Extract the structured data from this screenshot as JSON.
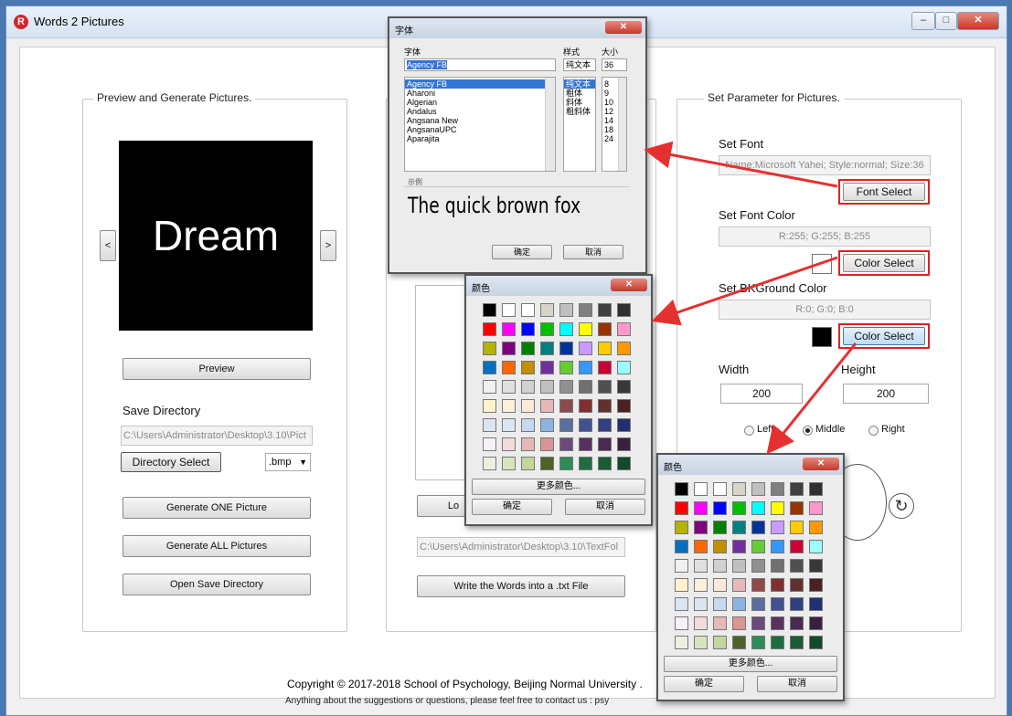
{
  "window": {
    "title": "Words 2 Pictures",
    "controls": [
      "–",
      "□",
      "✕"
    ]
  },
  "preview": {
    "group_title": "Preview and Generate Pictures.",
    "image_text": "Dream",
    "prev_label": "<",
    "next_label": ">",
    "preview_button": "Preview",
    "save_dir_label": "Save Directory",
    "save_dir_value": "C:\\Users\\Administrator\\Desktop\\3.10\\Pict",
    "dir_select_button": "Directory Select",
    "format_value": ".bmp",
    "generate_one_button": "Generate ONE Picture",
    "generate_all_button": "Generate ALL Pictures",
    "open_dir_button": "Open Save Directory"
  },
  "middle": {
    "load_button": "Lo",
    "txt_path": "C:\\Users\\Administrator\\Desktop\\3.10\\TextFol",
    "write_button": "Write the Words into a .txt File"
  },
  "params": {
    "group_title": "Set Parameter for Pictures.",
    "font_label": "Set Font",
    "font_value": "Name:Microsoft Yahei; Style:normal; Size:36",
    "font_select_button": "Font Select",
    "font_color_label": "Set Font Color",
    "font_color_value": "R:255; G:255; B:255",
    "color_select_button": "Color Select",
    "bg_color_label": "Set BKGround Color",
    "bg_color_value": "R:0; G:0; B:0",
    "bg_color_select_button": "Color Select",
    "width_label": "Width",
    "width_value": "200",
    "height_label": "Height",
    "height_value": "200",
    "align_left": "Left",
    "align_middle": "Middle",
    "align_right": "Right"
  },
  "footer": {
    "copyright": "Copyright © 2017-2018 School of Psychology, Beijing Normal University .",
    "contact": "Anything about the suggestions or questions, please feel free to contact us : psy"
  },
  "font_dialog": {
    "title": "字体",
    "font_col_label": "字体",
    "style_col_label": "样式",
    "size_col_label": "大小",
    "font_input": "Agency FB",
    "style_input": "纯文本",
    "size_input": "36",
    "fonts": [
      "Agency FB",
      "Aharoni",
      "Algerian",
      "Andalus",
      "Angsana New",
      "AngsanaUPC",
      "Aparajita"
    ],
    "styles": [
      "纯文本",
      "粗体",
      "斜体",
      "粗斜体"
    ],
    "sizes": [
      "8",
      "9",
      "10",
      "12",
      "14",
      "18",
      "24"
    ],
    "sample_label": "示例",
    "sample_text": "The quick brown fox",
    "ok_button": "确定",
    "cancel_button": "取消"
  },
  "color_dialog": {
    "title": "颜色",
    "more_colors_button": "更多颜色...",
    "ok_button": "确定",
    "cancel_button": "取消",
    "swatches": [
      [
        "#000000",
        "#ffffff",
        "#ffffff",
        "#d8d4c8",
        "#c0c0c0",
        "#808080",
        "#404040",
        "#303030"
      ],
      [
        "#ff0000",
        "#ff00ff",
        "#0000ff",
        "#00c000",
        "#00ffff",
        "#ffff00",
        "#993300",
        "#ff99cc"
      ],
      [
        "#b3b300",
        "#800080",
        "#008000",
        "#008080",
        "#003399",
        "#cc99ff",
        "#ffcc00",
        "#ff9900"
      ],
      [
        "#0070c0",
        "#ff6600",
        "#c09000",
        "#7030a0",
        "#66cc33",
        "#3399ff",
        "#cc0033",
        "#99ffff"
      ],
      [
        "#f0f0f0",
        "#e0e0e0",
        "#d0d0d0",
        "#c0c0c0",
        "#909090",
        "#707070",
        "#505050",
        "#383838"
      ],
      [
        "#fff2cc",
        "#fff0d9",
        "#fde9d9",
        "#e6b9b8",
        "#8c4a4a",
        "#803030",
        "#633030",
        "#4a2020"
      ],
      [
        "#dbe5f1",
        "#dce6f2",
        "#c6d9f0",
        "#8db3e2",
        "#5a6fa0",
        "#405090",
        "#304080",
        "#203070"
      ],
      [
        "#f8f0f8",
        "#f2dcdb",
        "#e5b9b7",
        "#d99694",
        "#6a4a7a",
        "#5a3060",
        "#4a2a50",
        "#3a2040"
      ],
      [
        "#ebf1de",
        "#d7e4bc",
        "#c3d69b",
        "#4f6228",
        "#2e8b57",
        "#1e6e40",
        "#1a5c36",
        "#124a2a"
      ]
    ]
  },
  "colors": {
    "highlight_red": "#e02020",
    "font_color_swatch": "#ffffff",
    "bg_color_swatch": "#000000"
  },
  "icons": {
    "refresh": "↻"
  }
}
